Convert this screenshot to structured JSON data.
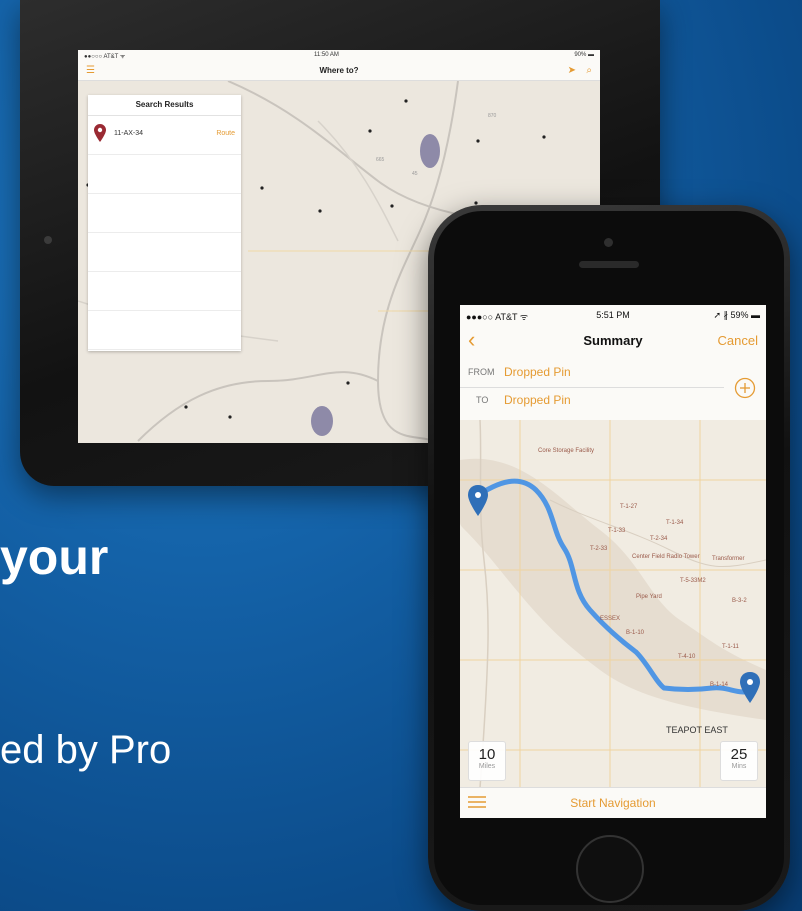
{
  "slide": {
    "heading": " your",
    "subtext": "ed by Pro"
  },
  "tablet": {
    "status": {
      "carrier": "●●○○○ AT&T ᯤ",
      "time": "11:50 AM",
      "battery": "90% ▬"
    },
    "nav": {
      "title": "Where to?",
      "menu_icon": "menu-icon",
      "location_icon": "location-arrow-icon",
      "search_icon": "search-icon"
    },
    "search_results": {
      "header": "Search Results",
      "items": [
        {
          "name": "11-AX-34",
          "action": "Route"
        }
      ]
    },
    "map": {
      "road_labels": [
        "870",
        "665",
        "45"
      ],
      "pin_color": "#9a2a33"
    }
  },
  "phone": {
    "status": {
      "carrier": "●●●○○ AT&T ᯤ",
      "time": "5:51 PM",
      "battery": "➚ ∦ 59% ▬"
    },
    "nav": {
      "back": "‹",
      "title": "Summary",
      "cancel": "Cancel"
    },
    "from": {
      "label": "FROM",
      "value": "Dropped Pin"
    },
    "to": {
      "label": "TO",
      "value": "Dropped Pin"
    },
    "map": {
      "labels": [
        "Core Storage Facility",
        "T-1-27",
        "T-1-34",
        "T-1-33",
        "T-2-34",
        "T-2-33",
        "Center Field Radio Tower",
        "Transformer",
        "T-5-33M2",
        "Pipe Yard",
        "B-3-2",
        "ESSEX",
        "B-1-10",
        "T-1-11",
        "T-4-10",
        "B-1-14",
        "TEAPOT EAST"
      ],
      "route_color": "#3f8ee6",
      "pin_color": "#2f6fb8"
    },
    "distance": {
      "value": "10",
      "unit": "Miles"
    },
    "duration": {
      "value": "25",
      "unit": "Mins"
    },
    "bottom": {
      "list_icon": "list-icon",
      "start": "Start Navigation"
    },
    "accent": "#e59b33"
  }
}
